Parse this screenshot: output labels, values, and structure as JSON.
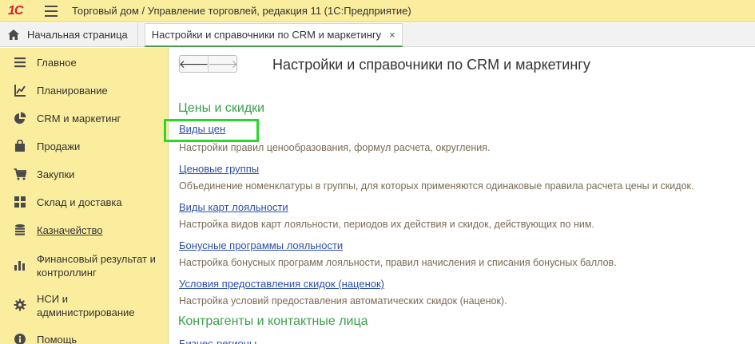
{
  "titlebar": {
    "logo": "1С",
    "title": "Торговый дом / Управление торговлей, редакция 11  (1С:Предприятие)"
  },
  "tabs": {
    "home_label": "Начальная страница",
    "active_label": "Настройки и справочники по CRM и маркетингу",
    "close_glyph": "×"
  },
  "sidebar": {
    "items": [
      {
        "label": "Главное",
        "icon": "hamburger-list-icon"
      },
      {
        "label": "Планирование",
        "icon": "planning-chart-icon"
      },
      {
        "label": "CRM и маркетинг",
        "icon": "pie-chart-icon"
      },
      {
        "label": "Продажи",
        "icon": "shopping-bag-icon"
      },
      {
        "label": "Закупки",
        "icon": "cart-icon"
      },
      {
        "label": "Склад и доставка",
        "icon": "warehouse-grid-icon"
      },
      {
        "label": "Казначейство",
        "icon": "coins-icon"
      },
      {
        "label": "Финансовый результат и контроллинг",
        "icon": "bar-chart-icon"
      },
      {
        "label": "НСИ и администрирование",
        "icon": "gear-icon"
      },
      {
        "label": "Помощь",
        "icon": "info-icon"
      }
    ]
  },
  "main": {
    "back_glyph": "🡐",
    "forward_glyph": "🡒",
    "page_title": "Настройки и справочники по CRM и маркетингу",
    "sections": [
      {
        "title": "Цены и скидки",
        "items": [
          {
            "link": "Виды цен",
            "desc": "Настройки правил ценообразования, формул расчета, округления."
          },
          {
            "link": "Ценовые группы",
            "desc": "Объединение номенклатуры в группы, для которых применяются одинаковые правила расчета цены и скидок."
          },
          {
            "link": "Виды карт лояльности",
            "desc": "Настройка видов карт лояльности, периодов их действия и скидок, действующих по ним."
          },
          {
            "link": "Бонусные программы лояльности",
            "desc": "Настройка бонусных программ лояльности, правил начисления и списания бонусных баллов."
          },
          {
            "link": "Условия предоставления скидок (наценок)",
            "desc": "Настройка условий предоставления автоматических скидок (наценок)."
          }
        ]
      },
      {
        "title": "Контрагенты и контактные лица",
        "items": [
          {
            "link": "Бизнес-регионы",
            "desc": ""
          }
        ]
      }
    ]
  },
  "colors": {
    "titlebar_bg": "#fbed9e",
    "section_green": "#3aa14a",
    "link_blue": "#2b4fa8",
    "highlight_green": "#2ad82a"
  }
}
